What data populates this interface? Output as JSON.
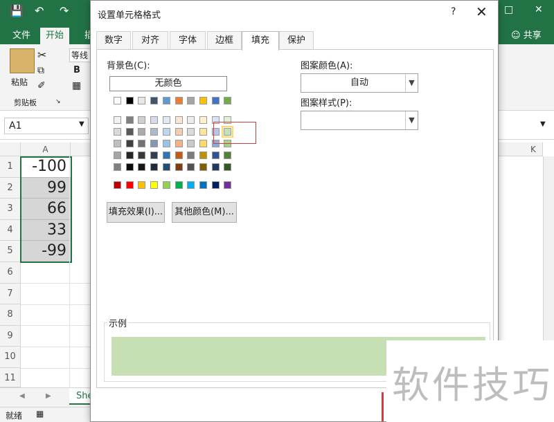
{
  "excel": {
    "tabs": [
      "文件",
      "开始",
      "插"
    ],
    "share": "共享",
    "ribbon": {
      "paste": "粘贴",
      "clipboard_group": "剪贴板",
      "font_name": "等线",
      "bold": "B"
    },
    "name_box": "A1",
    "column_a": "A",
    "column_k": "K",
    "rows": [
      "1",
      "2",
      "3",
      "4",
      "5",
      "6",
      "7",
      "8",
      "9",
      "10",
      "11"
    ],
    "cells": [
      "-100",
      "99",
      "66",
      "33",
      "-99"
    ],
    "sheet_tab": "She",
    "status": "就绪"
  },
  "dialog": {
    "title": "设置单元格格式",
    "help": "?",
    "close": "✕",
    "tabs": [
      "数字",
      "对齐",
      "字体",
      "边框",
      "填充",
      "保护"
    ],
    "active_tab": "填充",
    "background_color_label": "背景色(C):",
    "no_color": "无颜色",
    "fill_effects": "填充效果(I)...",
    "more_colors": "其他颜色(M)...",
    "pattern_color_label": "图案颜色(A):",
    "pattern_color_value": "自动",
    "pattern_style_label": "图案样式(P):",
    "pattern_style_value": "",
    "sample_label": "示例",
    "sample_color": "#c6e0b4",
    "theme_colors": [
      [
        "#ffffff",
        "#000000",
        "#e7e6e6",
        "#44546a",
        "#5b9bd5",
        "#ed7d31",
        "#a5a5a5",
        "#ffc000",
        "#4472c4",
        "#70ad47"
      ],
      [
        "#f2f2f2",
        "#808080",
        "#d0cece",
        "#d6dce4",
        "#deebf6",
        "#fbe5d5",
        "#ededed",
        "#fff2cc",
        "#dae3f3",
        "#e2efd9"
      ],
      [
        "#d9d9d9",
        "#595959",
        "#aeaaaa",
        "#adb9ca",
        "#bdd7ee",
        "#f7cbac",
        "#dbdbdb",
        "#fee599",
        "#b4c6e7",
        "#c6e0b4"
      ],
      [
        "#bfbfbf",
        "#404040",
        "#757171",
        "#8496b0",
        "#9cc3e5",
        "#f4b183",
        "#c9c9c9",
        "#ffd965",
        "#8eaadb",
        "#a9d18e"
      ],
      [
        "#a6a6a6",
        "#262626",
        "#3a3838",
        "#333f4f",
        "#2e75b5",
        "#c55a11",
        "#7b7b7b",
        "#bf9000",
        "#2f5496",
        "#538135"
      ],
      [
        "#7f7f7f",
        "#0d0d0d",
        "#171616",
        "#222a35",
        "#1e4e79",
        "#833c0b",
        "#525252",
        "#7f6000",
        "#1f3864",
        "#375623"
      ]
    ],
    "standard_colors": [
      "#c00000",
      "#ff0000",
      "#ffc000",
      "#ffff00",
      "#92d050",
      "#00b050",
      "#00b0f0",
      "#0070c0",
      "#002060",
      "#7030a0"
    ]
  },
  "watermark": "软件技巧"
}
